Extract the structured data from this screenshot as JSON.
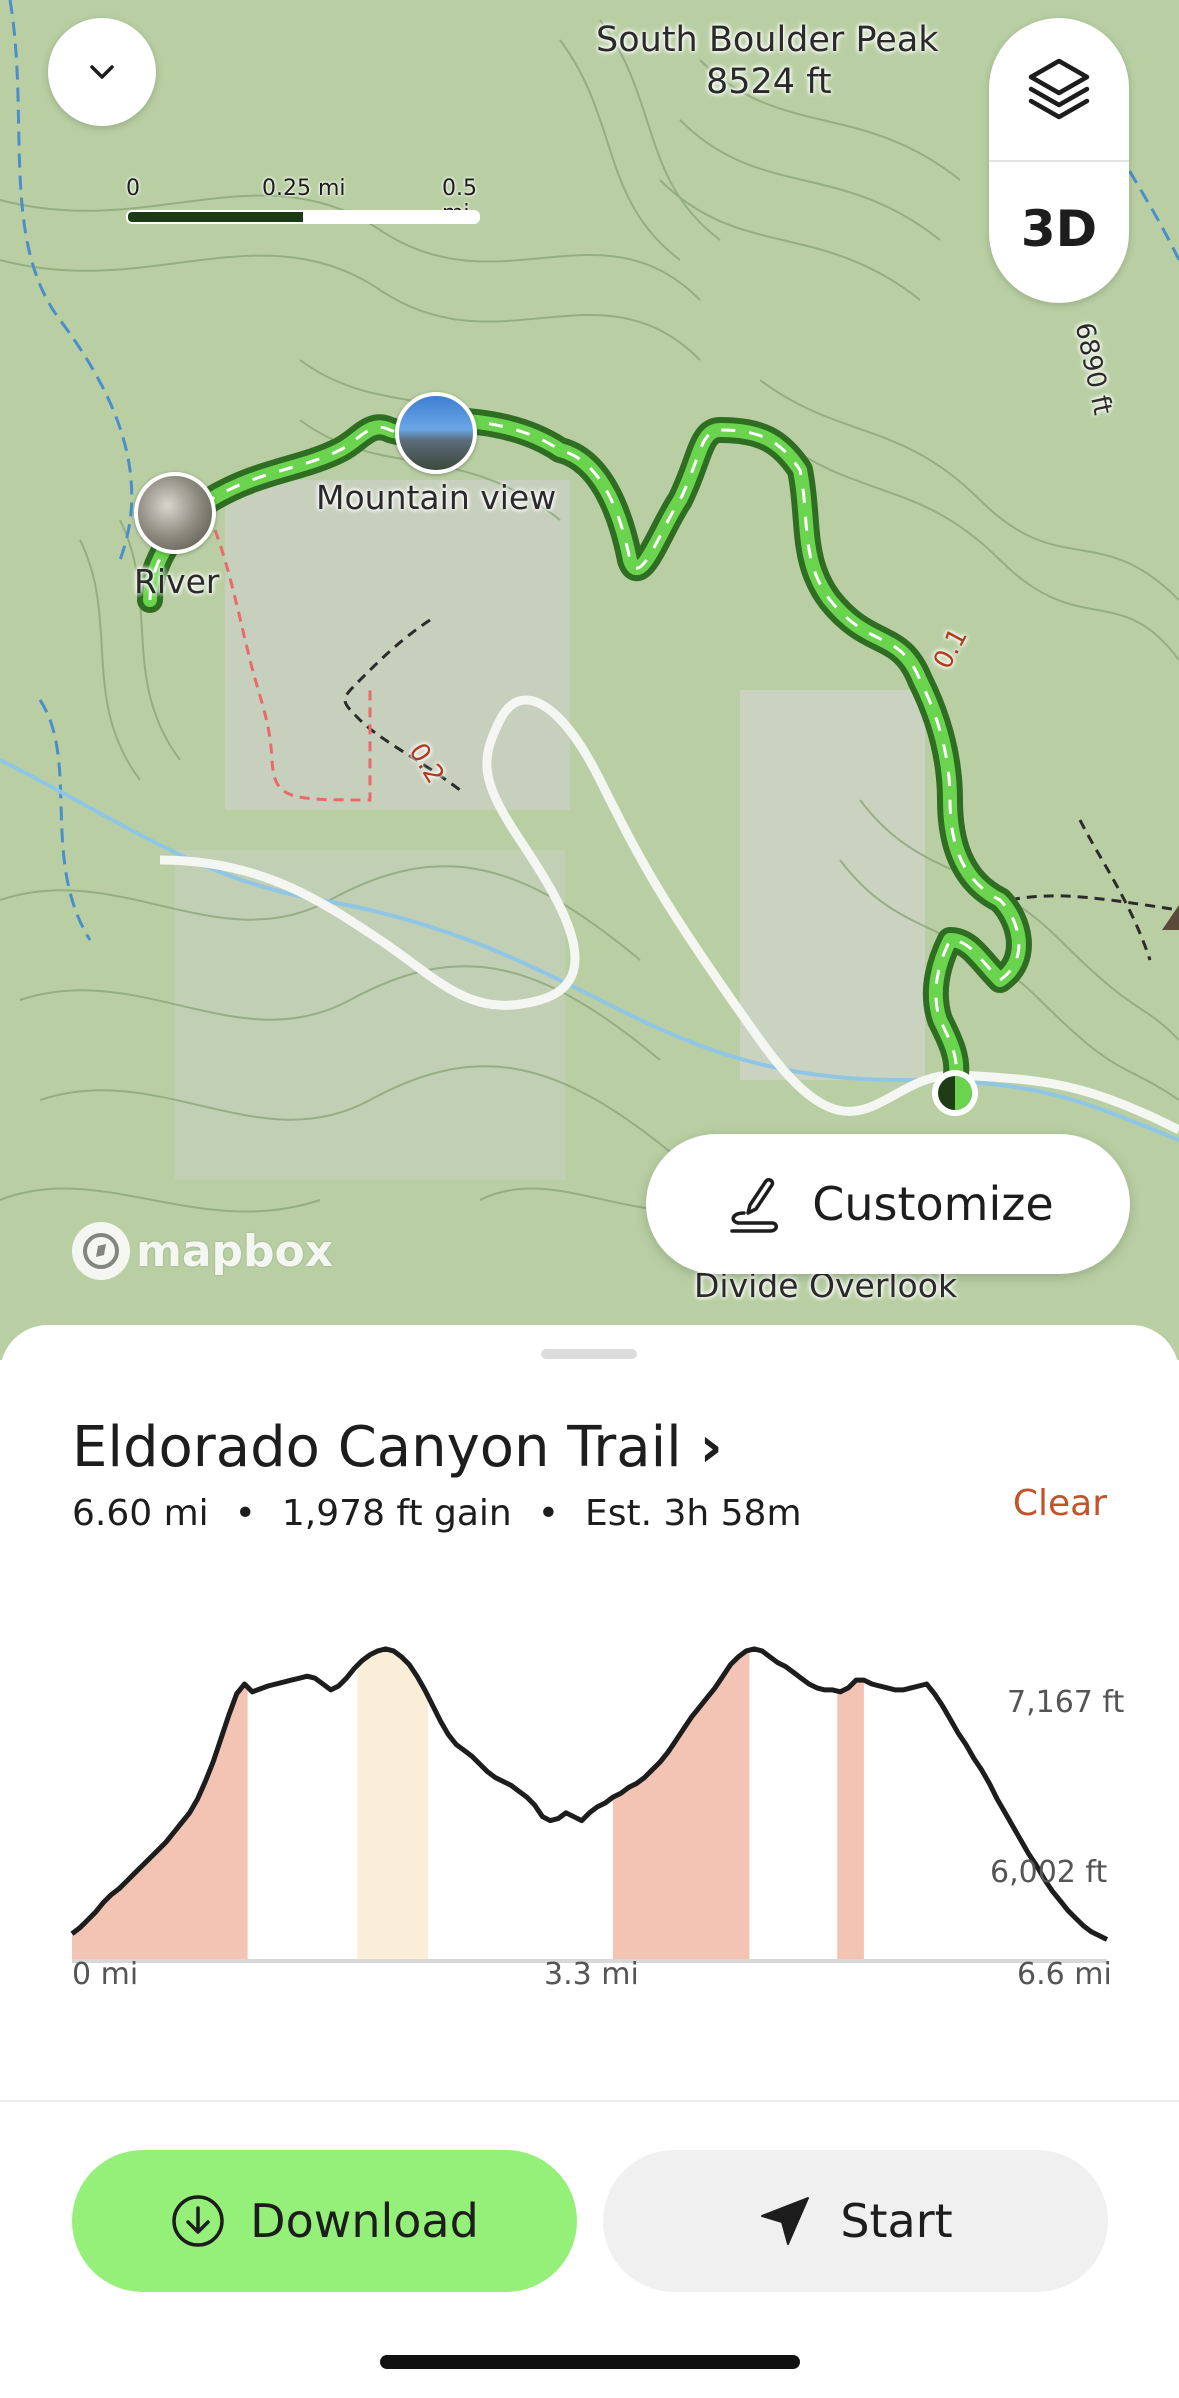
{
  "map": {
    "peak_label": "South Boulder Peak",
    "peak_elev": "8524 ft",
    "contour_label": "6890 ft",
    "waypoints": [
      {
        "label": "Mountain view"
      },
      {
        "label": "River"
      }
    ],
    "mile_markers": [
      "0.1",
      "0.2"
    ],
    "place_label": "Divide Overlook",
    "scale": {
      "labels": [
        "0",
        "0.25 mi",
        "0.5 mi"
      ]
    },
    "layers_button": {
      "icon": "layers-icon"
    },
    "btn_3d": "3D",
    "collapse_button": {
      "icon": "chevron-down-icon"
    },
    "customize_label": "Customize",
    "attribution": "mapbox"
  },
  "trail": {
    "name": "Eldorado Canyon Trail",
    "title_chevron": "›",
    "distance": "6.60 mi",
    "gain": "1,978 ft gain",
    "estimate": "Est. 3h 58m",
    "separator": "•",
    "clear_label": "Clear"
  },
  "chart_data": {
    "type": "area",
    "xlabel": "",
    "ylabel": "",
    "x_tick_labels": [
      "0 mi",
      "3.3 mi",
      "6.6 mi"
    ],
    "y_tick_labels": [
      "7,167 ft",
      "6,002 ft"
    ],
    "xlim": [
      0,
      6.6
    ],
    "ylim": [
      5720,
      7340
    ],
    "x": [
      0,
      0.05,
      0.1,
      0.15,
      0.2,
      0.25,
      0.3,
      0.35,
      0.4,
      0.45,
      0.5,
      0.55,
      0.6,
      0.65,
      0.7,
      0.75,
      0.8,
      0.85,
      0.9,
      0.95,
      1.0,
      1.05,
      1.1,
      1.15,
      1.2,
      1.25,
      1.3,
      1.35,
      1.4,
      1.45,
      1.5,
      1.55,
      1.6,
      1.65,
      1.7,
      1.75,
      1.8,
      1.85,
      1.9,
      1.95,
      2.0,
      2.05,
      2.1,
      2.15,
      2.2,
      2.25,
      2.3,
      2.35,
      2.4,
      2.45,
      2.5,
      2.55,
      2.6,
      2.65,
      2.7,
      2.75,
      2.8,
      2.85,
      2.9,
      2.95,
      3.0,
      3.05,
      3.1,
      3.15,
      3.2,
      3.25,
      3.3,
      3.35,
      3.4,
      3.45,
      3.5,
      3.55,
      3.6,
      3.65,
      3.7,
      3.75,
      3.8,
      3.85,
      3.9,
      3.95,
      4.0,
      4.05,
      4.1,
      4.15,
      4.2,
      4.25,
      4.3,
      4.35,
      4.4,
      4.45,
      4.5,
      4.55,
      4.6,
      4.65,
      4.7,
      4.75,
      4.8,
      4.85,
      4.9,
      4.95,
      5.0,
      5.05,
      5.1,
      5.15,
      5.2,
      5.25,
      5.3,
      5.35,
      5.4,
      5.45,
      5.5,
      5.55,
      5.6,
      5.65,
      5.7,
      5.75,
      5.8,
      5.85,
      5.9,
      5.95,
      6.0,
      6.05,
      6.1,
      6.15,
      6.2,
      6.25,
      6.3,
      6.35,
      6.4,
      6.45,
      6.5,
      6.55,
      6.6
    ],
    "y": [
      5860,
      5890,
      5930,
      5970,
      6020,
      6060,
      6090,
      6130,
      6170,
      6210,
      6250,
      6290,
      6330,
      6380,
      6430,
      6480,
      6550,
      6640,
      6740,
      6860,
      6980,
      7090,
      7140,
      7100,
      7115,
      7130,
      7140,
      7150,
      7160,
      7170,
      7180,
      7170,
      7140,
      7110,
      7130,
      7170,
      7220,
      7260,
      7290,
      7310,
      7320,
      7310,
      7280,
      7240,
      7180,
      7110,
      7030,
      6950,
      6880,
      6830,
      6800,
      6770,
      6730,
      6690,
      6660,
      6640,
      6620,
      6590,
      6560,
      6520,
      6460,
      6440,
      6450,
      6480,
      6460,
      6440,
      6480,
      6510,
      6530,
      6560,
      6580,
      6610,
      6630,
      6660,
      6700,
      6740,
      6790,
      6850,
      6910,
      6970,
      7020,
      7070,
      7120,
      7180,
      7240,
      7280,
      7310,
      7320,
      7310,
      7280,
      7250,
      7230,
      7200,
      7170,
      7140,
      7120,
      7110,
      7110,
      7100,
      7120,
      7160,
      7160,
      7140,
      7130,
      7120,
      7110,
      7110,
      7120,
      7130,
      7140,
      7090,
      7030,
      6960,
      6890,
      6830,
      6760,
      6700,
      6630,
      6550,
      6480,
      6410,
      6340,
      6270,
      6210,
      6140,
      6080,
      6030,
      5980,
      5940,
      5900,
      5870,
      5850,
      5830
    ],
    "bands": [
      {
        "from": 0.0,
        "to": 1.12,
        "color": "#f3c3b4"
      },
      {
        "from": 1.82,
        "to": 2.27,
        "color": "#faeed9"
      },
      {
        "from": 3.45,
        "to": 4.32,
        "color": "#f3c3b4"
      },
      {
        "from": 4.88,
        "to": 5.05,
        "color": "#f3c3b4"
      }
    ],
    "line_color": "#1d1d1d"
  },
  "actions": {
    "download_label": "Download",
    "download_icon": "download-icon",
    "start_label": "Start",
    "start_icon": "navigation-arrow-icon"
  },
  "colors": {
    "accent_green": "#95f07a",
    "route_green": "#6ad44f",
    "clear_orange": "#c4532a",
    "map_base": "#b9cfa3"
  }
}
